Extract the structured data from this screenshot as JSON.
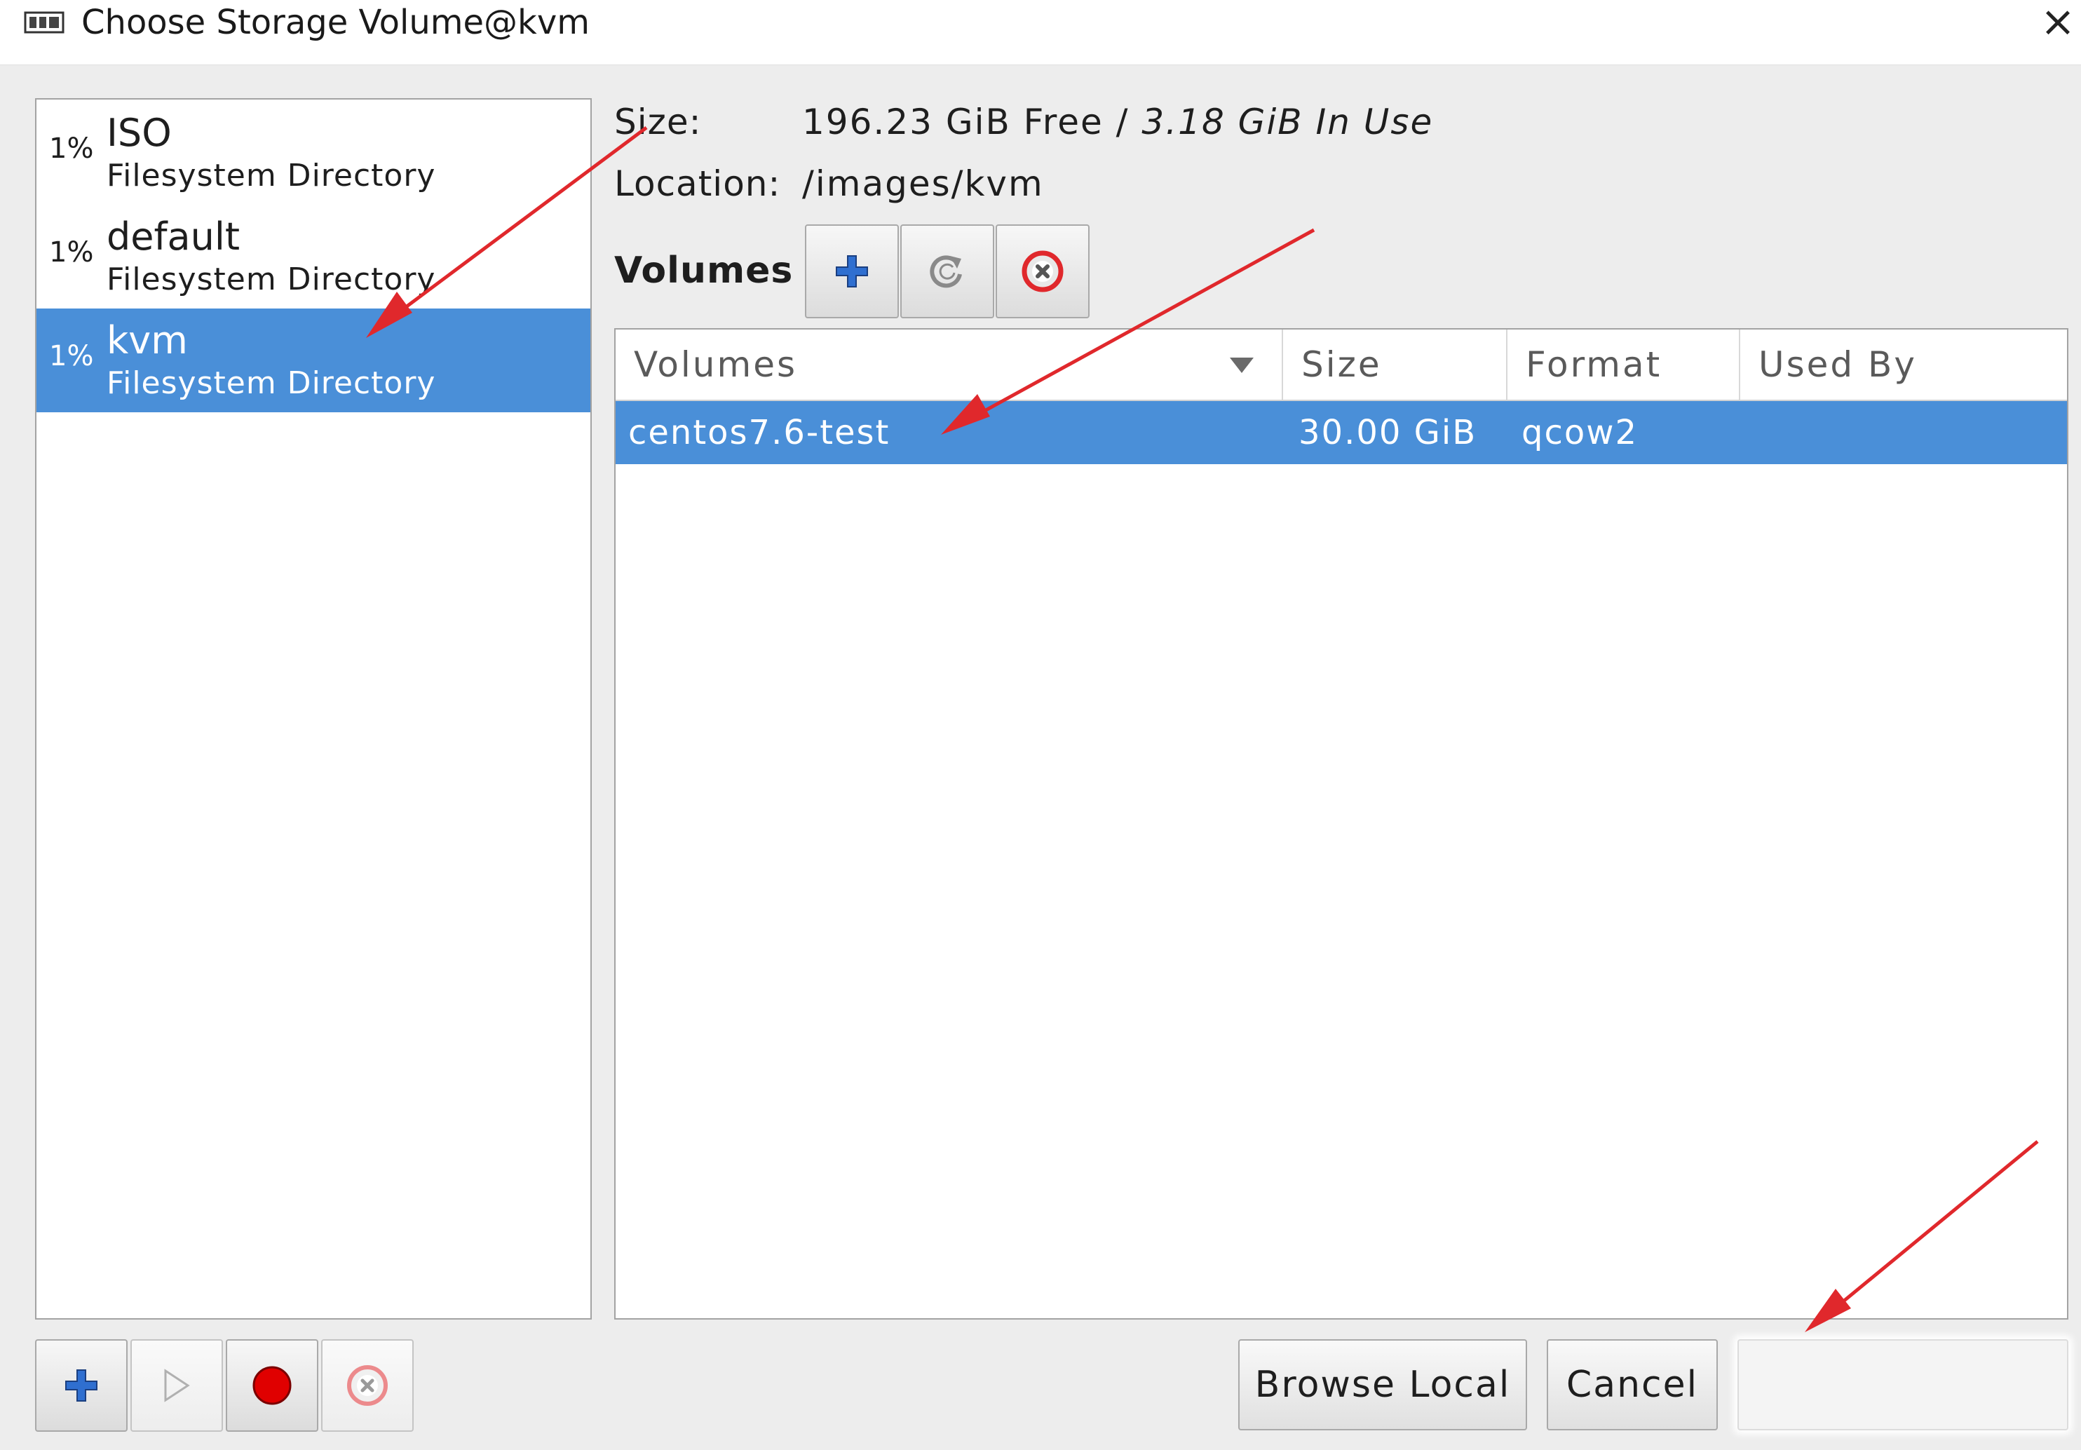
{
  "window": {
    "title": "Choose Storage Volume@kvm",
    "close_glyph": "×"
  },
  "pools": [
    {
      "usage": "1%",
      "name": "ISO",
      "type": "Filesystem Directory",
      "selected": false
    },
    {
      "usage": "1%",
      "name": "default",
      "type": "Filesystem Directory",
      "selected": false
    },
    {
      "usage": "1%",
      "name": "kvm",
      "type": "Filesystem Directory",
      "selected": true
    }
  ],
  "pool_details": {
    "size_label": "Size:",
    "size_free": "196.23 GiB Free",
    "size_separator": " / ",
    "size_in_use": "3.18 GiB In Use",
    "location_label": "Location:",
    "location_value": "/images/kvm"
  },
  "volumes_section": {
    "heading": "Volumes",
    "toolbar_icons": [
      "add-icon",
      "refresh-icon",
      "delete-icon"
    ]
  },
  "volume_table": {
    "columns": [
      "Volumes",
      "Size",
      "Format",
      "Used By"
    ],
    "rows": [
      {
        "name": "centos7.6-test",
        "size": "30.00 GiB",
        "format": "qcow2",
        "used_by": "",
        "selected": true
      }
    ]
  },
  "pool_toolbar_icons": [
    "add-pool-icon",
    "start-pool-icon",
    "stop-pool-icon",
    "delete-pool-icon"
  ],
  "buttons": {
    "browse_local": "Browse Local",
    "cancel": "Cancel",
    "choose_volume": ""
  },
  "colors": {
    "selection": "#4a8fd8",
    "annotation_arrow": "#e0282c",
    "stop_red": "#e00000",
    "add_blue": "#2f6fd0"
  }
}
